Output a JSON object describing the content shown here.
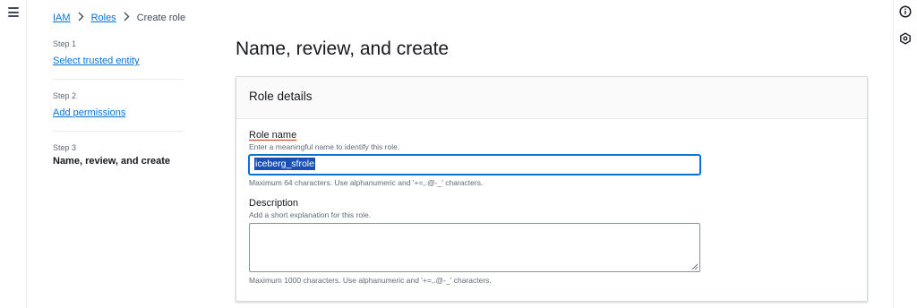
{
  "breadcrumb": {
    "iam": "IAM",
    "roles": "Roles",
    "current": "Create role"
  },
  "steps": [
    {
      "num": "Step 1",
      "label": "Select trusted entity"
    },
    {
      "num": "Step 2",
      "label": "Add permissions"
    },
    {
      "num": "Step 3",
      "label": "Name, review, and create"
    }
  ],
  "page_title": "Name, review, and create",
  "card": {
    "title": "Role details",
    "role_name": {
      "label": "Role name",
      "description": "Enter a meaningful name to identify this role.",
      "value": "iceberg_sfrole",
      "constraint": "Maximum 64 characters. Use alphanumeric and '+=,.@-_' characters."
    },
    "description_field": {
      "label": "Description",
      "description": "Add a short explanation for this role.",
      "value": "",
      "constraint": "Maximum 1000 characters. Use alphanumeric and '+=,.@-_' characters."
    }
  },
  "icons": {
    "menu": "hamburger-icon",
    "info": "info-icon",
    "settings": "hexagon-settings-icon"
  },
  "colors": {
    "link": "#0972d3",
    "selection": "#1a4fb4",
    "label_underline": "#d13212"
  }
}
